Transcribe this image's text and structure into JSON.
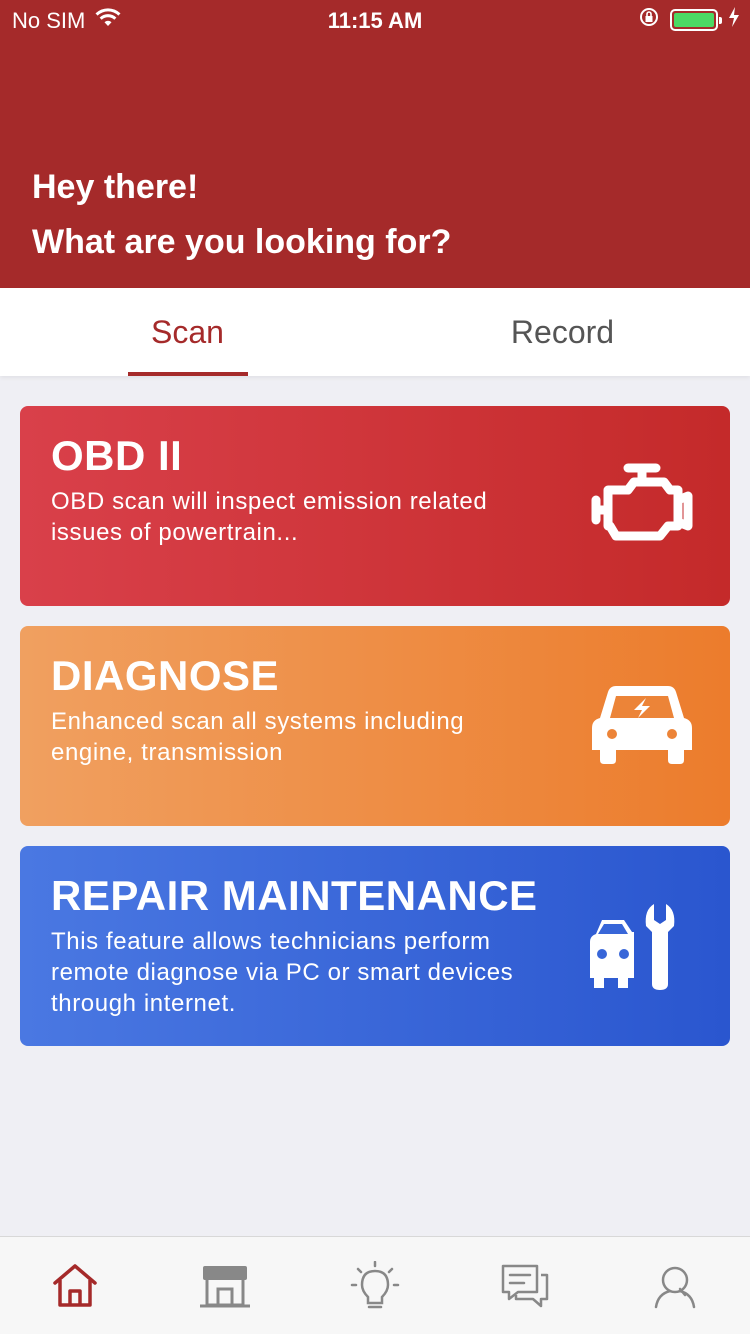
{
  "status_bar": {
    "carrier": "No SIM",
    "time": "11:15 AM",
    "battery_color": "#4cd964"
  },
  "header": {
    "line1": "Hey there!",
    "line2": "What are you looking for?",
    "background": "#a52a2a"
  },
  "tabs": [
    {
      "label": "Scan",
      "active": true
    },
    {
      "label": "Record",
      "active": false
    }
  ],
  "cards": [
    {
      "title": "OBD II",
      "description": "OBD scan will inspect emission related issues of powertrain...",
      "icon": "engine-check-icon"
    },
    {
      "title": "DIAGNOSE",
      "description": "Enhanced scan all systems including engine, transmission",
      "icon": "car-electric-icon"
    },
    {
      "title": "REPAIR MAINTENANCE",
      "description": "This feature allows technicians perform remote diagnose via PC or smart devices through internet.",
      "icon": "car-wrench-icon"
    }
  ],
  "bottom_nav": [
    {
      "icon": "home-icon",
      "active": true
    },
    {
      "icon": "store-icon",
      "active": false
    },
    {
      "icon": "lightbulb-icon",
      "active": false
    },
    {
      "icon": "chat-icon",
      "active": false
    },
    {
      "icon": "profile-icon",
      "active": false
    }
  ]
}
